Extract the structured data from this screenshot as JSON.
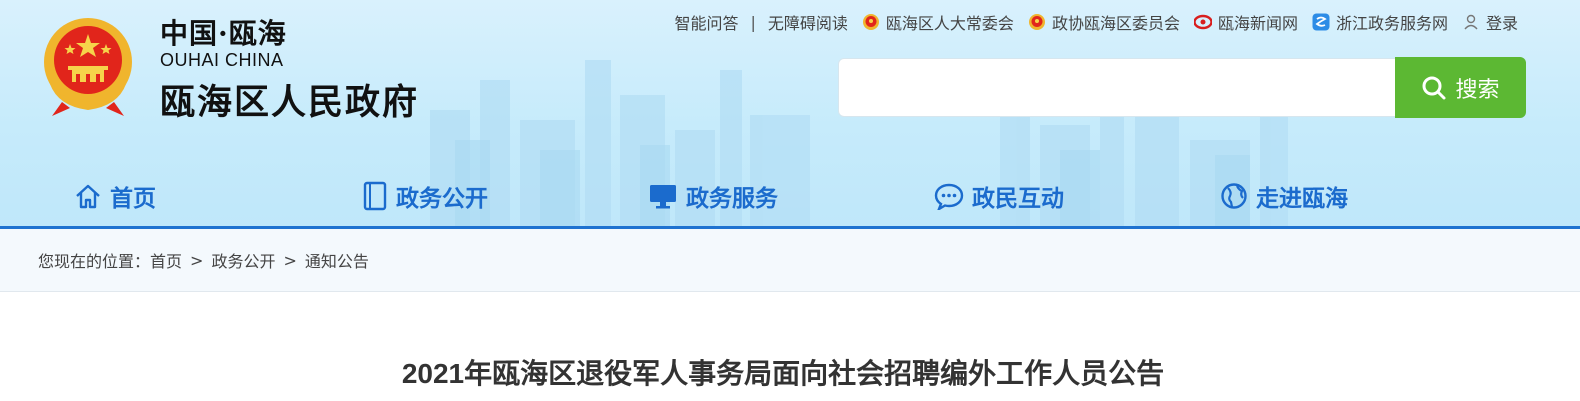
{
  "brand": {
    "line1": "中国·瓯海",
    "line2": "OUHAI CHINA",
    "line3": "瓯海区人民政府"
  },
  "toplinks": {
    "qa": "智能问答",
    "separator": "|",
    "accessibility": "无障碍阅读",
    "people_congress": "瓯海区人大常委会",
    "cppcc": "政协瓯海区委员会",
    "news": "瓯海新闻网",
    "zj_service": "浙江政务服务网",
    "login": "登录"
  },
  "search": {
    "placeholder": "",
    "button_label": "搜索"
  },
  "nav": {
    "items": [
      {
        "label": "首页",
        "icon": "home-icon"
      },
      {
        "label": "政务公开",
        "icon": "document-icon"
      },
      {
        "label": "政务服务",
        "icon": "monitor-icon"
      },
      {
        "label": "政民互动",
        "icon": "chat-icon"
      },
      {
        "label": "走进瓯海",
        "icon": "globe-icon"
      }
    ]
  },
  "breadcrumb": {
    "prefix": "您现在的位置：",
    "items": [
      "首页",
      "政务公开",
      "通知公告"
    ],
    "separator": ">"
  },
  "article": {
    "title": "2021年瓯海区退役军人事务局面向社会招聘编外工作人员公告"
  },
  "colors": {
    "nav_text": "#1b6bcd",
    "search_button": "#5cb833",
    "header_bg": "#c6ebfb"
  }
}
